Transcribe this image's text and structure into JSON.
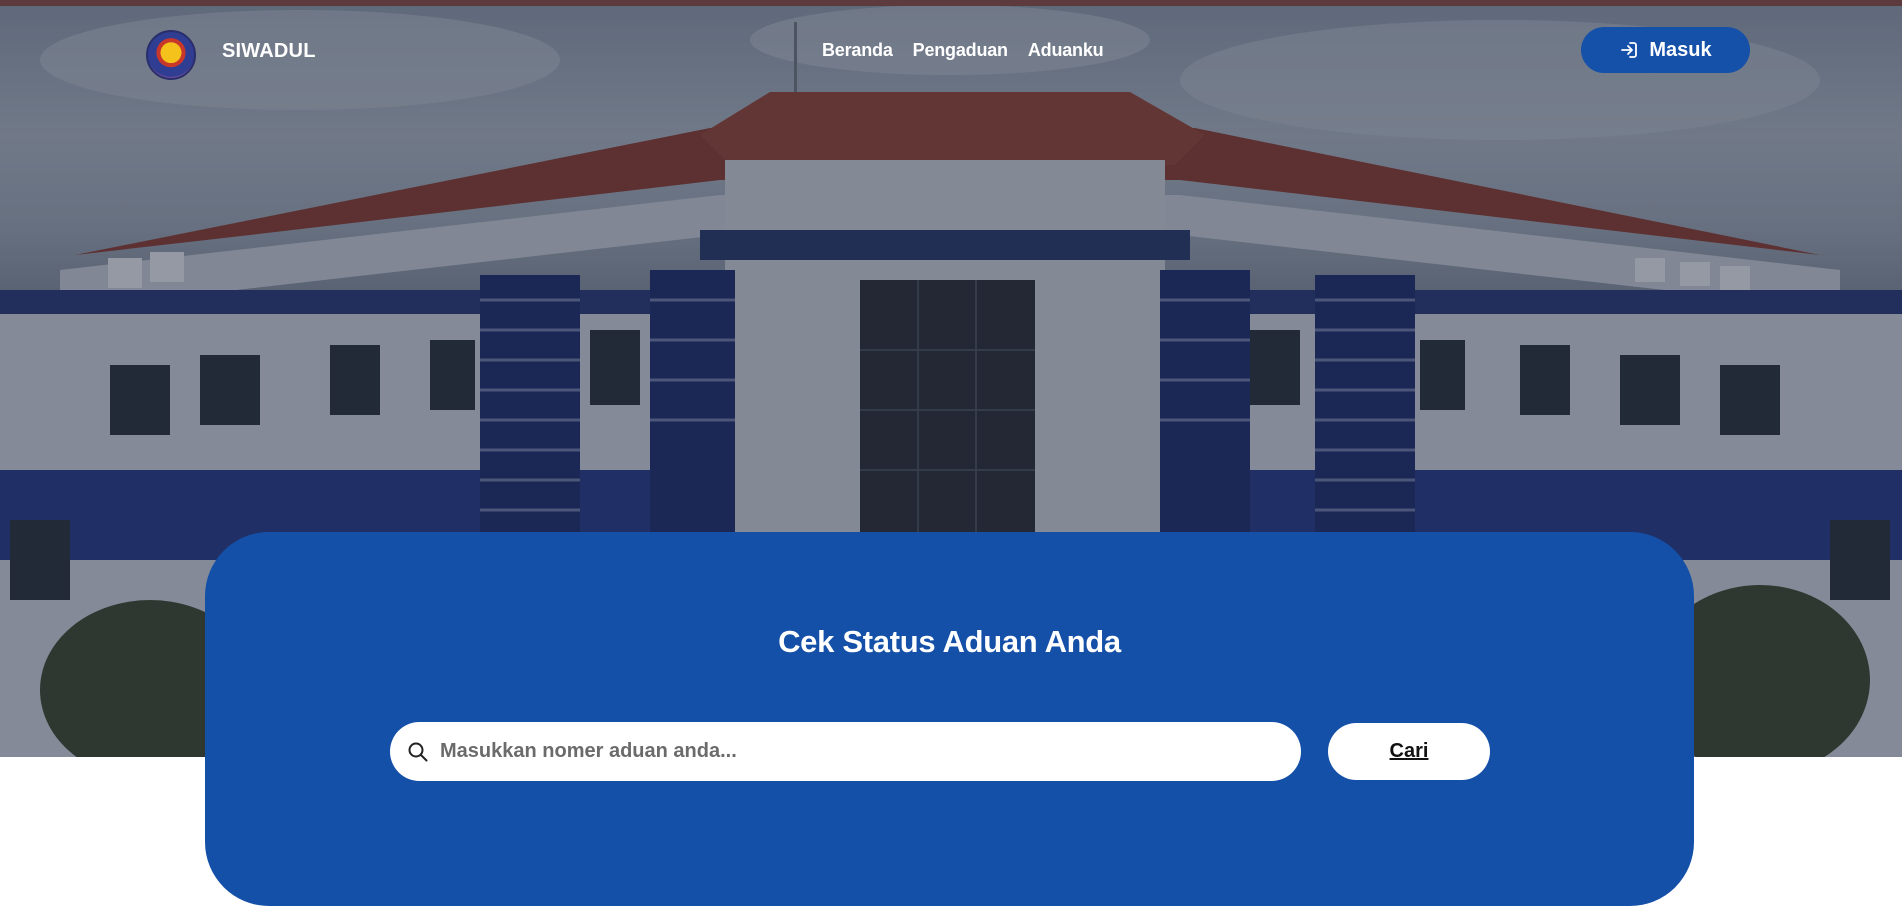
{
  "app": {
    "brand_name": "SIWADUL",
    "logo_icon": "university-emblem-icon"
  },
  "nav": {
    "items": [
      {
        "label": "Beranda"
      },
      {
        "label": "Pengaduan"
      },
      {
        "label": "Aduanku"
      }
    ],
    "login_label": "Masuk",
    "login_icon": "login-arrow-icon"
  },
  "hero": {
    "image_subject": "building-photo"
  },
  "status_card": {
    "title": "Cek Status Aduan Anda",
    "search_placeholder": "Masukkan nomer aduan anda...",
    "search_value": "",
    "search_icon": "search-icon",
    "search_button_label": "Cari"
  },
  "colors": {
    "primary": "#1450a8",
    "button": "#1550a9",
    "top_strip": "#5c3a3e",
    "text_on_primary": "#ffffff"
  }
}
